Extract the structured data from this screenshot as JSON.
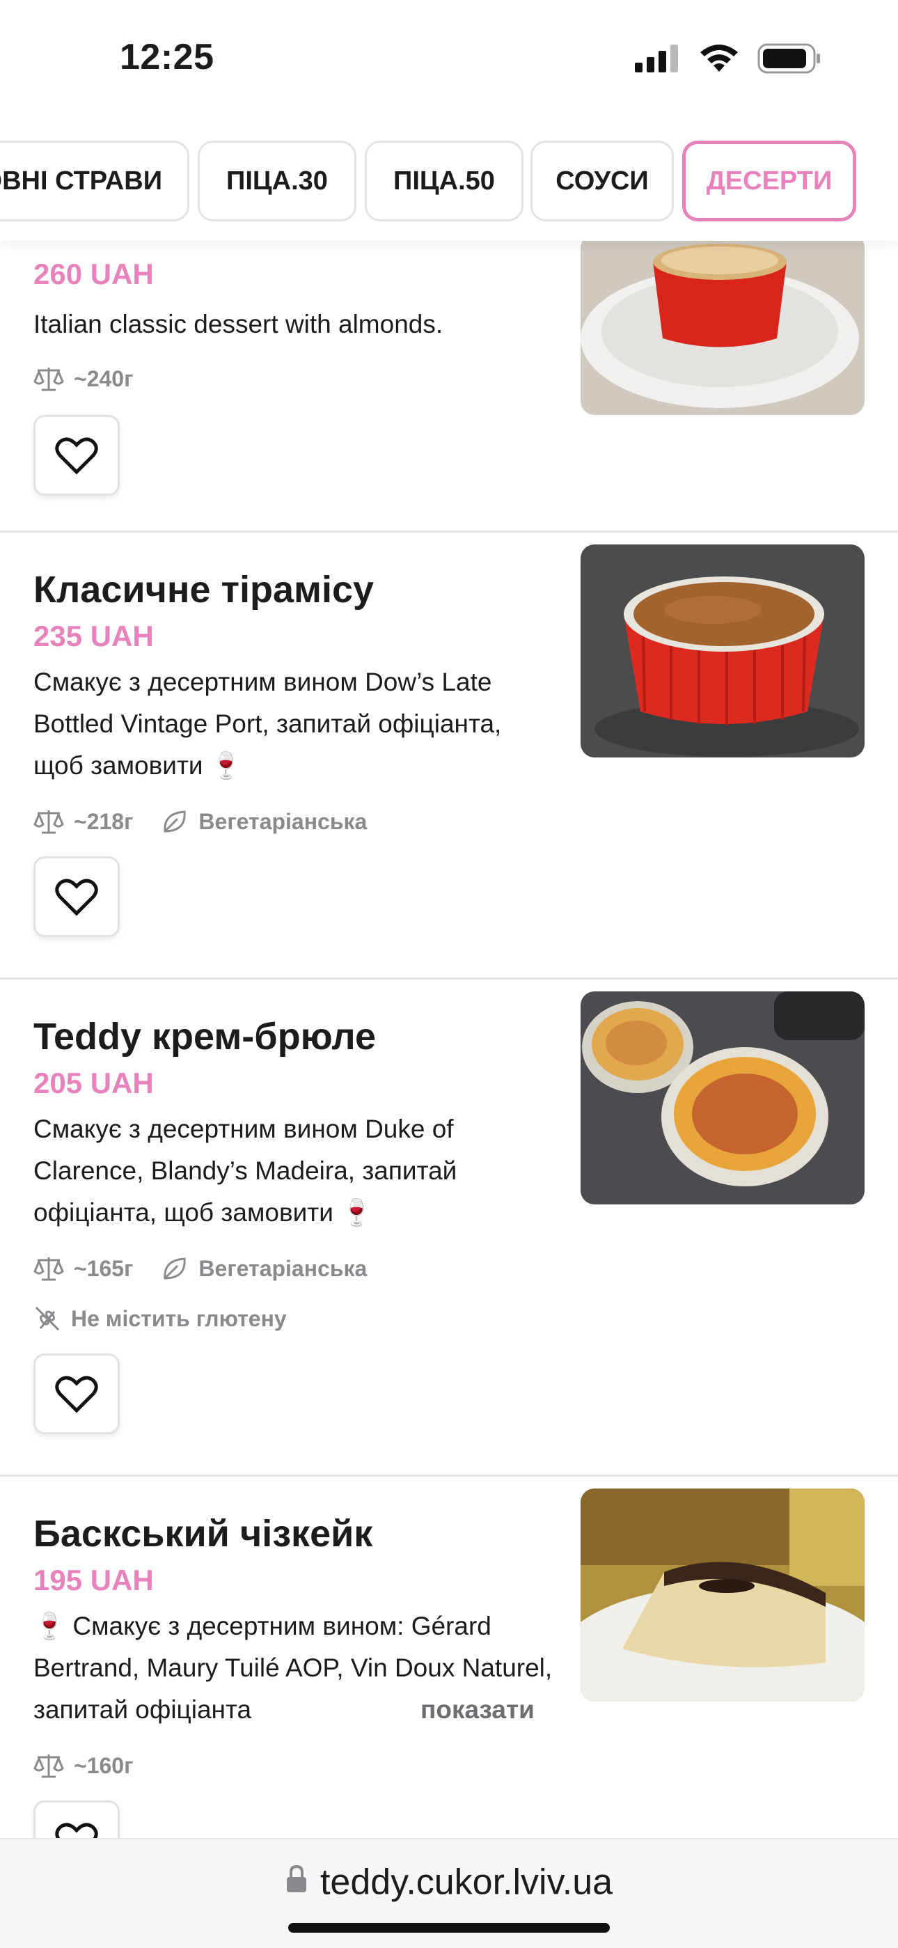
{
  "status": {
    "time": "12:25"
  },
  "tabs": [
    {
      "label": "ОВНІ СТРАВИ",
      "active": false
    },
    {
      "label": "ПІЦА.30",
      "active": false
    },
    {
      "label": "ПІЦА.50",
      "active": false
    },
    {
      "label": "СОУСИ",
      "active": false
    },
    {
      "label": "ДЕСЕРТИ",
      "active": true
    }
  ],
  "items": [
    {
      "price": "260 UAH",
      "description": "Italian classic dessert with almonds.",
      "weight": "~240г"
    },
    {
      "title": "Класичне тірамісу",
      "price": "235 UAH",
      "description": "Смакує з десертним вином Dow’s Late Bottled Vintage Port, запитай офіціанта, щоб замовити 🍷",
      "weight": "~218г",
      "tag": "Вегетаріанська"
    },
    {
      "title": "Teddy крем-брюле",
      "price": "205 UAH",
      "description": "Смакує з десертним вином Duke of Clarence, Blandy’s Madeira, запитай офіціанта, щоб замовити 🍷",
      "weight": "~165г",
      "tag": "Вегетаріанська",
      "tag2": "Не містить глютену"
    },
    {
      "title": "Баскський чізкейк",
      "price": "195 UAH",
      "description": "🍷 Смакує з десертним вином: Gérard Bertrand, Maury Tuilé AOP, Vin Doux Naturel, запитай офіціанта",
      "show_more": "показати",
      "weight": "~160г"
    }
  ],
  "browser": {
    "url": "teddy.cukor.lviv.ua"
  },
  "colors": {
    "accent": "#e882bd",
    "muted": "#8a8a8e"
  }
}
